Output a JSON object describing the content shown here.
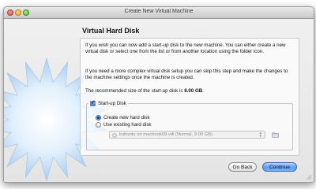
{
  "window": {
    "title": "Create New Virtual Machine"
  },
  "page": {
    "heading": "Virtual Hard Disk",
    "paragraph1": "If you wish you can now add a start-up disk to the new machine. You can either create a new virtual disk or select one from the list or from another location using the folder icon.",
    "paragraph2": "If you need a more complex virtual disk setup you can skip this step and make the changes to the machine settings once the machine is created.",
    "recommendation_prefix": "The recommended size of the start-up disk is ",
    "recommendation_size": "8.00 GB",
    "recommendation_suffix": "."
  },
  "startup_disk": {
    "checkbox_label": "Start-up Disk",
    "checked": true,
    "options": [
      {
        "label": "Create new hard disk",
        "selected": true
      },
      {
        "label": "Use existing hard disk",
        "selected": false
      }
    ],
    "existing_disk_value": "kubuntu on macbook09.vdi (Normal, 9.00 GB)",
    "existing_disk_icon": "disk-icon",
    "folder_icon": "folder-icon"
  },
  "buttons": {
    "back": "Go Back",
    "continue": "Continue"
  },
  "colors": {
    "accent": "#5d9cf0",
    "starburst": "#bcd9f4"
  }
}
